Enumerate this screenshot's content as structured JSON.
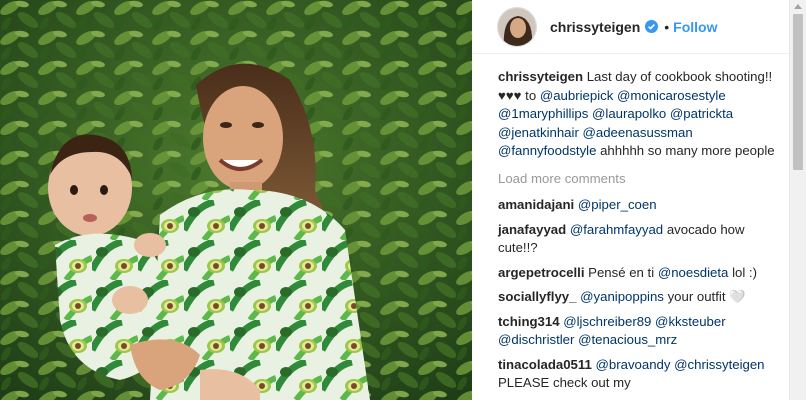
{
  "header": {
    "username": "chrissyteigen",
    "separator": "•",
    "follow_label": "Follow"
  },
  "caption": {
    "username": "chrissyteigen",
    "text_1": " Last day of cookbook shooting!! ♥♥♥ to ",
    "mentions_1": "@aubriepick @monicarosestyle @1maryphillips @laurapolko @patrickta @jenatkinhair @adeenasussman @fannyfoodstyle",
    "text_2": " ahhhhh so many more people"
  },
  "load_more_label": "Load more comments",
  "comments": [
    {
      "username": "amanidajani",
      "mention": "@piper_coen",
      "text": ""
    },
    {
      "username": "janafayyad",
      "mention": "@farahmfayyad",
      "text": " avocado how cute!!?"
    },
    {
      "username": "argepetrocelli",
      "text_before": " Pensé en ti ",
      "mention": "@noesdieta",
      "text": " lol :)"
    },
    {
      "username": "sociallyflyy_",
      "mention": "@yanipoppins",
      "text": " your outfit 🤍"
    },
    {
      "username": "tching314",
      "mention": "@ljschreiber89 @kksteuber @dischristler @tenacious_mrz",
      "text": ""
    },
    {
      "username": "tinacolada0511",
      "mention": "@bravoandy @chrissyteigen",
      "text": " PLEASE check out my"
    }
  ],
  "colors": {
    "link_blue": "#3897f0",
    "mention_blue": "#003569",
    "muted_gray": "#999999",
    "text_dark": "#262626",
    "verified_blue": "#3897f0"
  },
  "icons": {
    "verified": "verified-badge-icon",
    "scroll": "scroll-up-arrow-icon"
  }
}
